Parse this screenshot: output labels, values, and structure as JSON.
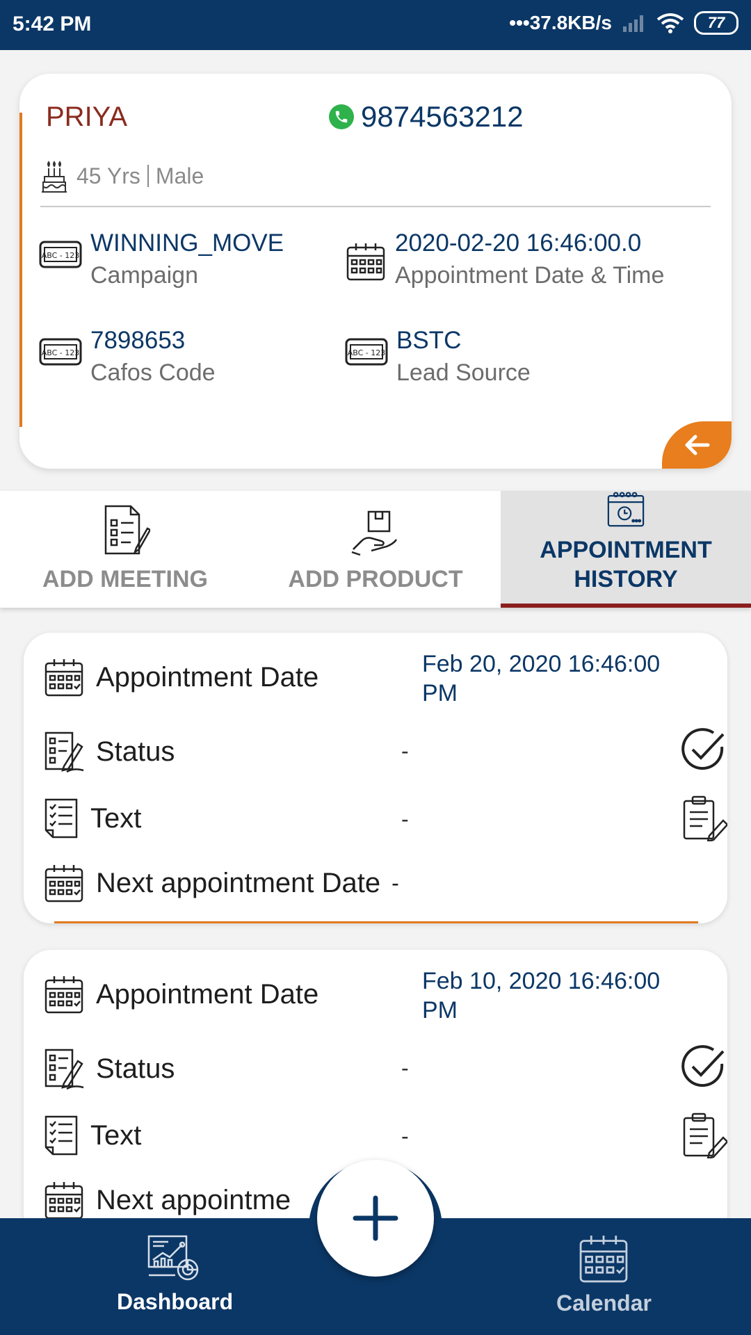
{
  "status_bar": {
    "time": "5:42 PM",
    "network_speed": "•••37.8KB/s",
    "battery": "77"
  },
  "patient": {
    "name": "PRIYA",
    "phone": "9874563212",
    "age": "45 Yrs",
    "gender": "Male",
    "fields": [
      {
        "value": "WINNING_MOVE",
        "label": "Campaign",
        "icon": "id-card-icon"
      },
      {
        "value": "2020-02-20 16:46:00.0",
        "label": "Appointment Date & Time",
        "icon": "calendar-icon"
      },
      {
        "value": "7898653",
        "label": "Cafos Code",
        "icon": "id-card-icon"
      },
      {
        "value": "BSTC",
        "label": "Lead Source",
        "icon": "id-card-icon"
      }
    ]
  },
  "tabs": [
    {
      "label": "ADD MEETING",
      "icon": "meeting-checklist-icon",
      "active": false
    },
    {
      "label": "ADD PRODUCT",
      "icon": "product-hand-icon",
      "active": false
    },
    {
      "label": "APPOINTMENT HISTORY",
      "icon": "calendar-clock-icon",
      "active": true
    }
  ],
  "history_labels": {
    "appointment_date": "Appointment Date",
    "status": "Status",
    "text": "Text",
    "next_date": "Next appointment Date",
    "next_date_truncated": "Next appointme"
  },
  "history": [
    {
      "appointment_date": "Feb 20, 2020 16:46:00 PM",
      "status": "-",
      "text": "-",
      "next_date": "-"
    },
    {
      "appointment_date": "Feb 10, 2020 16:46:00 PM",
      "status": "-",
      "text": "-",
      "next_date": "-"
    }
  ],
  "bottom_nav": {
    "dashboard": "Dashboard",
    "calendar": "Calendar"
  },
  "colors": {
    "primary": "#0b3766",
    "accent": "#e07a1e",
    "name": "#8b2b1f",
    "active_tab_underline": "#8b1e1e"
  }
}
